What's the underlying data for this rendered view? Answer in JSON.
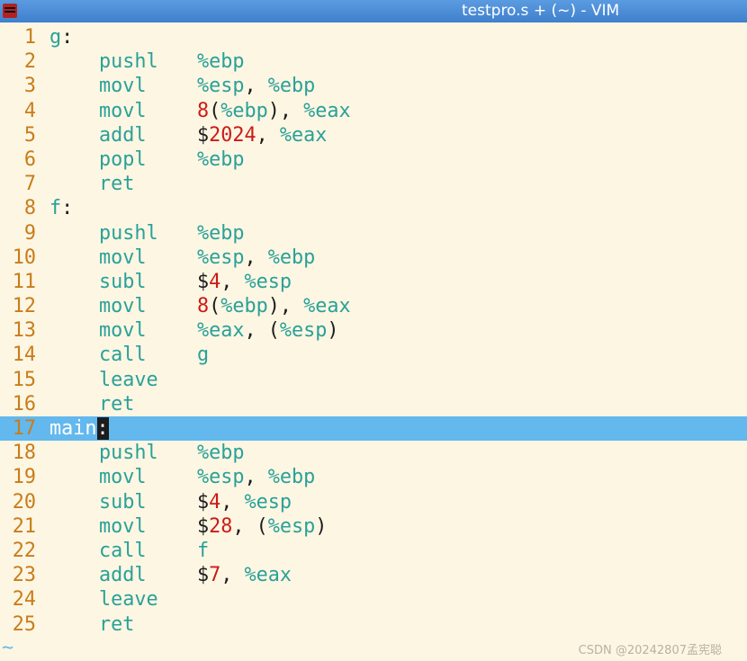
{
  "window": {
    "title": "testpro.s + (~) - VIM",
    "icon": "vim-app-icon"
  },
  "editor": {
    "lines": [
      {
        "num": "1",
        "label": "g",
        "colon": ":"
      },
      {
        "num": "2",
        "mnemonic": "pushl",
        "ops": [
          {
            "t": "reg",
            "v": "%ebp"
          }
        ]
      },
      {
        "num": "3",
        "mnemonic": "movl",
        "ops": [
          {
            "t": "reg",
            "v": "%esp"
          },
          {
            "t": "punct",
            "v": ", "
          },
          {
            "t": "reg",
            "v": "%ebp"
          }
        ]
      },
      {
        "num": "4",
        "mnemonic": "movl",
        "ops": [
          {
            "t": "num",
            "v": "8"
          },
          {
            "t": "punct",
            "v": "("
          },
          {
            "t": "reg",
            "v": "%ebp"
          },
          {
            "t": "punct",
            "v": "), "
          },
          {
            "t": "reg",
            "v": "%eax"
          }
        ]
      },
      {
        "num": "5",
        "mnemonic": "addl",
        "ops": [
          {
            "t": "punct",
            "v": "$"
          },
          {
            "t": "num",
            "v": "2024"
          },
          {
            "t": "punct",
            "v": ", "
          },
          {
            "t": "reg",
            "v": "%eax"
          }
        ]
      },
      {
        "num": "6",
        "mnemonic": "popl",
        "ops": [
          {
            "t": "reg",
            "v": "%ebp"
          }
        ]
      },
      {
        "num": "7",
        "mnemonic": "ret",
        "ops": []
      },
      {
        "num": "8",
        "label": "f",
        "colon": ":"
      },
      {
        "num": "9",
        "mnemonic": "pushl",
        "ops": [
          {
            "t": "reg",
            "v": "%ebp"
          }
        ]
      },
      {
        "num": "10",
        "mnemonic": "movl",
        "ops": [
          {
            "t": "reg",
            "v": "%esp"
          },
          {
            "t": "punct",
            "v": ", "
          },
          {
            "t": "reg",
            "v": "%ebp"
          }
        ]
      },
      {
        "num": "11",
        "mnemonic": "subl",
        "ops": [
          {
            "t": "punct",
            "v": "$"
          },
          {
            "t": "num",
            "v": "4"
          },
          {
            "t": "punct",
            "v": ", "
          },
          {
            "t": "reg",
            "v": "%esp"
          }
        ]
      },
      {
        "num": "12",
        "mnemonic": "movl",
        "ops": [
          {
            "t": "num",
            "v": "8"
          },
          {
            "t": "punct",
            "v": "("
          },
          {
            "t": "reg",
            "v": "%ebp"
          },
          {
            "t": "punct",
            "v": "), "
          },
          {
            "t": "reg",
            "v": "%eax"
          }
        ]
      },
      {
        "num": "13",
        "mnemonic": "movl",
        "ops": [
          {
            "t": "reg",
            "v": "%eax"
          },
          {
            "t": "punct",
            "v": ", ("
          },
          {
            "t": "reg",
            "v": "%esp"
          },
          {
            "t": "punct",
            "v": ")"
          }
        ]
      },
      {
        "num": "14",
        "mnemonic": "call",
        "ops": [
          {
            "t": "reg",
            "v": "g"
          }
        ]
      },
      {
        "num": "15",
        "mnemonic": "leave",
        "ops": []
      },
      {
        "num": "16",
        "mnemonic": "ret",
        "ops": []
      },
      {
        "num": "17",
        "label": "main",
        "colon": ":",
        "cursorline": true
      },
      {
        "num": "18",
        "mnemonic": "pushl",
        "ops": [
          {
            "t": "reg",
            "v": "%ebp"
          }
        ]
      },
      {
        "num": "19",
        "mnemonic": "movl",
        "ops": [
          {
            "t": "reg",
            "v": "%esp"
          },
          {
            "t": "punct",
            "v": ", "
          },
          {
            "t": "reg",
            "v": "%ebp"
          }
        ]
      },
      {
        "num": "20",
        "mnemonic": "subl",
        "ops": [
          {
            "t": "punct",
            "v": "$"
          },
          {
            "t": "num",
            "v": "4"
          },
          {
            "t": "punct",
            "v": ", "
          },
          {
            "t": "reg",
            "v": "%esp"
          }
        ]
      },
      {
        "num": "21",
        "mnemonic": "movl",
        "ops": [
          {
            "t": "punct",
            "v": "$"
          },
          {
            "t": "num",
            "v": "28"
          },
          {
            "t": "punct",
            "v": ", ("
          },
          {
            "t": "reg",
            "v": "%esp"
          },
          {
            "t": "punct",
            "v": ")"
          }
        ]
      },
      {
        "num": "22",
        "mnemonic": "call",
        "ops": [
          {
            "t": "reg",
            "v": "f"
          }
        ]
      },
      {
        "num": "23",
        "mnemonic": "addl",
        "ops": [
          {
            "t": "punct",
            "v": "$"
          },
          {
            "t": "num",
            "v": "7"
          },
          {
            "t": "punct",
            "v": ", "
          },
          {
            "t": "reg",
            "v": "%eax"
          }
        ]
      },
      {
        "num": "24",
        "mnemonic": "leave",
        "ops": []
      },
      {
        "num": "25",
        "mnemonic": "ret",
        "ops": []
      }
    ],
    "empty_line_marker": "~"
  },
  "watermark": "CSDN @20242807孟宪聪",
  "colors": {
    "background": "#fdf6e3",
    "line_number": "#c87d1a",
    "keyword": "#2aa198",
    "number": "#cb1b16",
    "text": "#1c1c1c",
    "cursorline": "#63b8ee",
    "titlebar": "#4a8ad6"
  }
}
